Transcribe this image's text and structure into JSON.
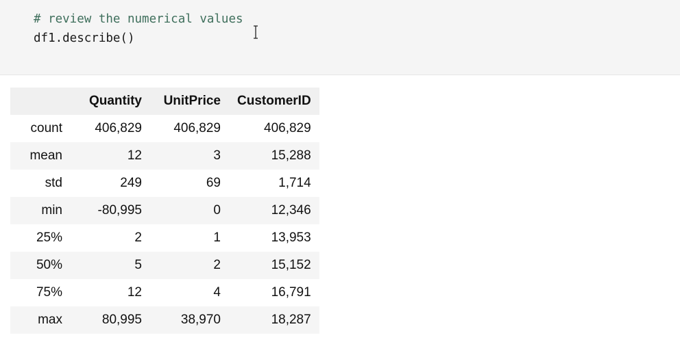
{
  "code_cell": {
    "comment": "# review the numerical values",
    "code": "df1.describe()"
  },
  "output_table": {
    "columns": [
      "",
      "Quantity",
      "UnitPrice",
      "CustomerID"
    ],
    "rows": [
      {
        "label": "count",
        "values": [
          "406,829",
          "406,829",
          "406,829"
        ]
      },
      {
        "label": "mean",
        "values": [
          "12",
          "3",
          "15,288"
        ]
      },
      {
        "label": "std",
        "values": [
          "249",
          "69",
          "1,714"
        ]
      },
      {
        "label": "min",
        "values": [
          "-80,995",
          "0",
          "12,346"
        ]
      },
      {
        "label": "25%",
        "values": [
          "2",
          "1",
          "13,953"
        ]
      },
      {
        "label": "50%",
        "values": [
          "5",
          "2",
          "15,152"
        ]
      },
      {
        "label": "75%",
        "values": [
          "12",
          "4",
          "16,791"
        ]
      },
      {
        "label": "max",
        "values": [
          "80,995",
          "38,970",
          "18,287"
        ]
      }
    ]
  },
  "colors": {
    "cell_background": "#f5f5f5",
    "comment_text": "#3f6f5c",
    "header_background": "#f0f0f0",
    "striped_row": "#f5f5f5"
  },
  "icons": {
    "cursor": "text-cursor-icon"
  }
}
